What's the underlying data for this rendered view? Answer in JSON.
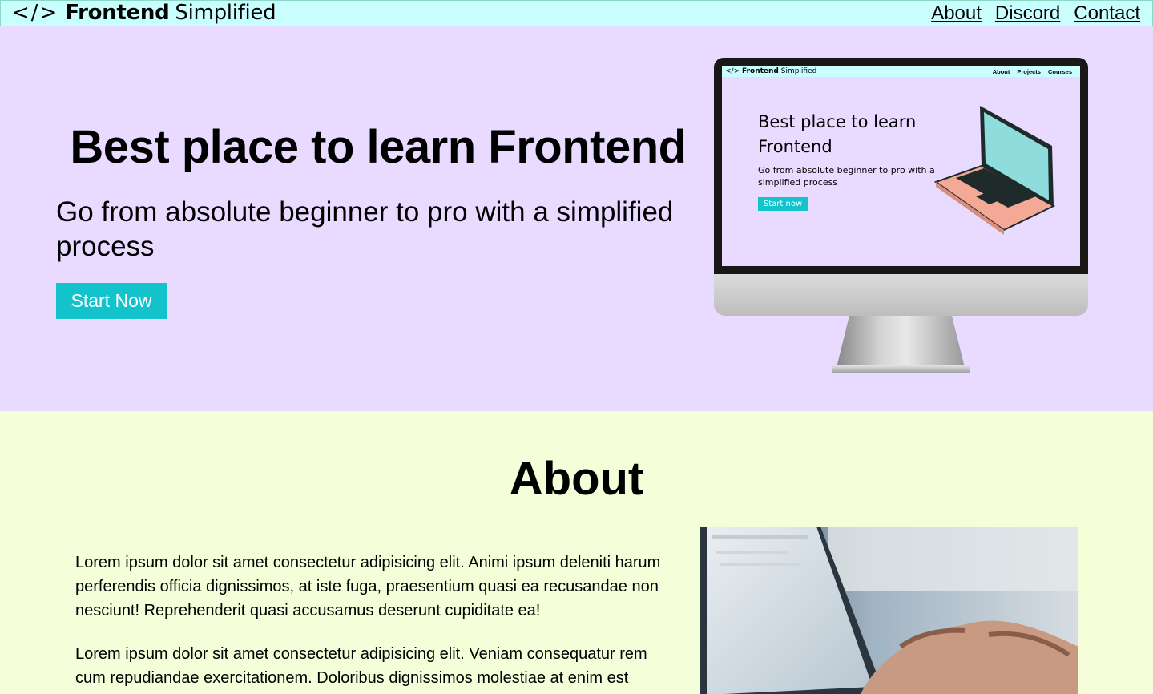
{
  "navbar": {
    "logo_symbol": "</>",
    "brand_bold": "Frontend",
    "brand_light": "Simplified",
    "links": [
      "About",
      "Discord",
      "Contact"
    ]
  },
  "hero": {
    "title": "Best place to learn Frontend",
    "subtitle": "Go from absolute beginner to pro with a simplified process",
    "button_label": "Start Now"
  },
  "monitor_screen": {
    "logo_symbol": "</>",
    "brand_bold": "Frontend",
    "brand_light": "Simplified",
    "links": [
      "About",
      "Projects",
      "Courses"
    ],
    "title": "Best place to learn Frontend",
    "subtitle": "Go from absolute beginner to pro with a simplified process",
    "button_label": "Start now"
  },
  "about": {
    "title": "About",
    "paragraphs": [
      "Lorem ipsum dolor sit amet consectetur adipisicing elit. Animi ipsum deleniti harum perferendis officia dignissimos, at iste fuga, praesentium quasi ea recusandae non nesciunt! Reprehenderit quasi accusamus deserunt cupiditate ea!",
      "Lorem ipsum dolor sit amet consectetur adipisicing elit. Veniam consequatur rem cum repudiandae exercitationem. Doloribus dignissimos molestiae at enim est"
    ]
  },
  "colors": {
    "navbar_bg": "#c9feff",
    "hero_bg": "#e9dbff",
    "about_bg": "#f4ffd9",
    "accent": "#12c3cc"
  }
}
